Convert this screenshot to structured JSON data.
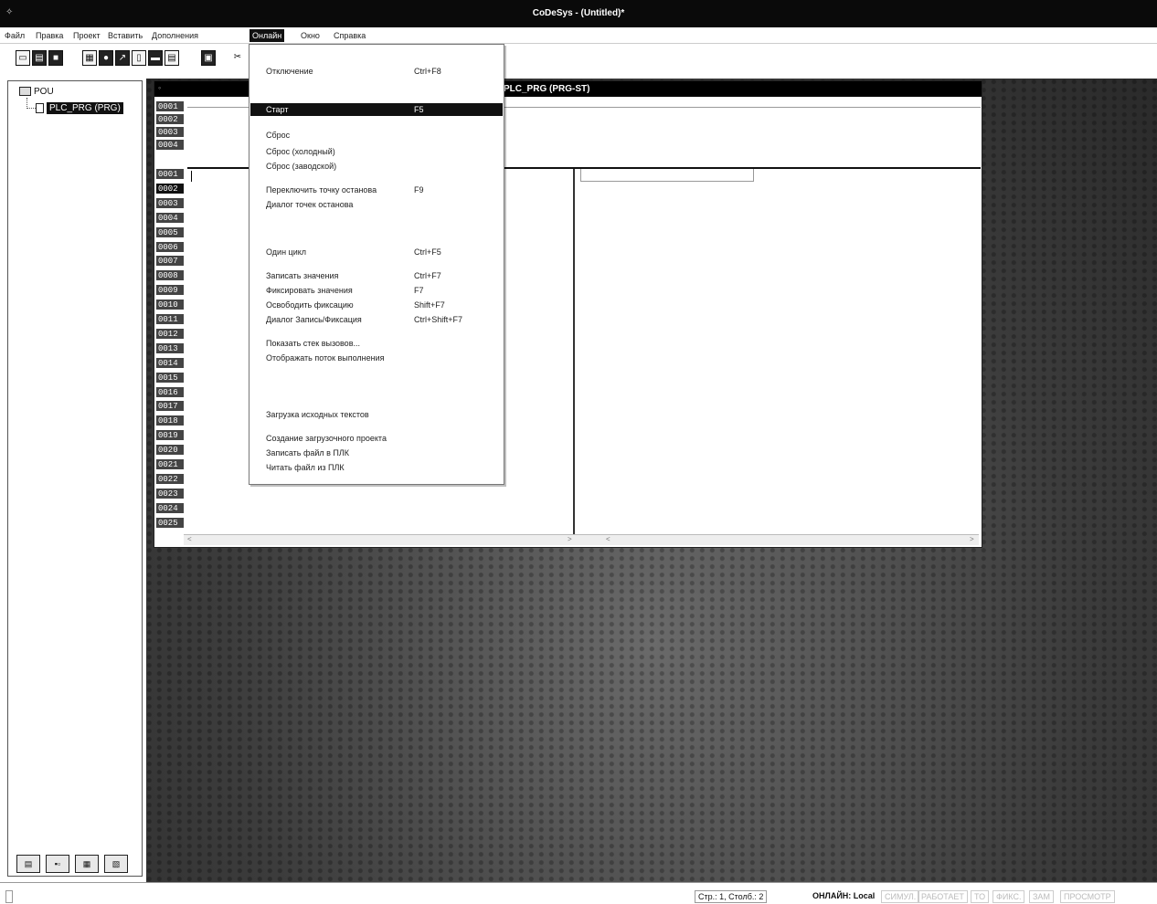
{
  "window": {
    "title": "CoDeSys - (Untitled)*",
    "system_icon": "✧"
  },
  "menubar": {
    "items": [
      {
        "label": "Файл"
      },
      {
        "label": "Правка"
      },
      {
        "label": "Проект"
      },
      {
        "label": "Вставить"
      },
      {
        "label": "Дополнения"
      },
      {
        "label": "Онлайн",
        "active": true
      },
      {
        "label": "Окно"
      },
      {
        "label": "Справка"
      }
    ]
  },
  "toolbar": {
    "buttons": [
      "new-icon",
      "open-icon",
      "save-icon",
      "build-icon",
      "login-icon",
      "logout-icon",
      "run-icon",
      "stop-icon",
      "print-icon",
      "cut-icon"
    ]
  },
  "project_tree": {
    "root": "POU",
    "node": "PLC_PRG (PRG)"
  },
  "editor": {
    "title": "PLC_PRG (PRG-ST)",
    "decl_lines": [
      "0001",
      "0002",
      "0003",
      "0004"
    ],
    "code_lines": [
      "0001",
      "0002",
      "0003",
      "0004",
      "0005",
      "0006",
      "0007",
      "0008",
      "0009",
      "0010",
      "0011",
      "0012",
      "0013",
      "0014",
      "0015",
      "0016",
      "0017",
      "0018",
      "0019",
      "0020",
      "0021",
      "0022",
      "0023",
      "0024",
      "0025"
    ],
    "scroll_left": "<",
    "scroll_right": ">"
  },
  "online_menu": {
    "items": [
      {
        "label": "Отключение",
        "shortcut": "Ctrl+F8",
        "state": "normal"
      },
      {
        "label": "Старт",
        "shortcut": "F5",
        "state": "highlighted"
      },
      {
        "label": "Сброс",
        "shortcut": "",
        "state": "normal"
      },
      {
        "label": "Сброс (холодный)",
        "shortcut": "",
        "state": "normal"
      },
      {
        "label": "Сброс (заводской)",
        "shortcut": "",
        "state": "normal"
      },
      {
        "label": "Переключить точку останова",
        "shortcut": "F9",
        "state": "normal"
      },
      {
        "label": "Диалог точек останова",
        "shortcut": "",
        "state": "normal"
      },
      {
        "label": "Один цикл",
        "shortcut": "Ctrl+F5",
        "state": "normal"
      },
      {
        "label": "Записать значения",
        "shortcut": "Ctrl+F7",
        "state": "normal"
      },
      {
        "label": "Фиксировать значения",
        "shortcut": "F7",
        "state": "normal"
      },
      {
        "label": "Освободить фиксацию",
        "shortcut": "Shift+F7",
        "state": "normal"
      },
      {
        "label": "Диалог Запись/Фиксация",
        "shortcut": "Ctrl+Shift+F7",
        "state": "normal"
      },
      {
        "label": "Показать стек вызовов...",
        "shortcut": "",
        "state": "normal"
      },
      {
        "label": "Отображать поток выполнения",
        "shortcut": "",
        "state": "normal"
      },
      {
        "label": "Загрузка исходных текстов",
        "shortcut": "",
        "state": "normal"
      },
      {
        "label": "Создание загрузочного проекта",
        "shortcut": "",
        "state": "normal"
      },
      {
        "label": "Записать файл в ПЛК",
        "shortcut": "",
        "state": "normal"
      },
      {
        "label": "Читать файл из ПЛК",
        "shortcut": "",
        "state": "normal"
      }
    ]
  },
  "left_tabs": [
    "POUs",
    "Data types",
    "Visualizations",
    "Resources"
  ],
  "statusbar": {
    "position": "Стр.: 1, Столб.: 2",
    "online": "ОНЛАЙН: Local",
    "sim": "СИМУЛ.",
    "running": "РАБОТАЕТ",
    "bp": "ТО",
    "force": "ФИКС.",
    "ovr": "ЗАМ",
    "view": "ПРОСМОТР"
  }
}
